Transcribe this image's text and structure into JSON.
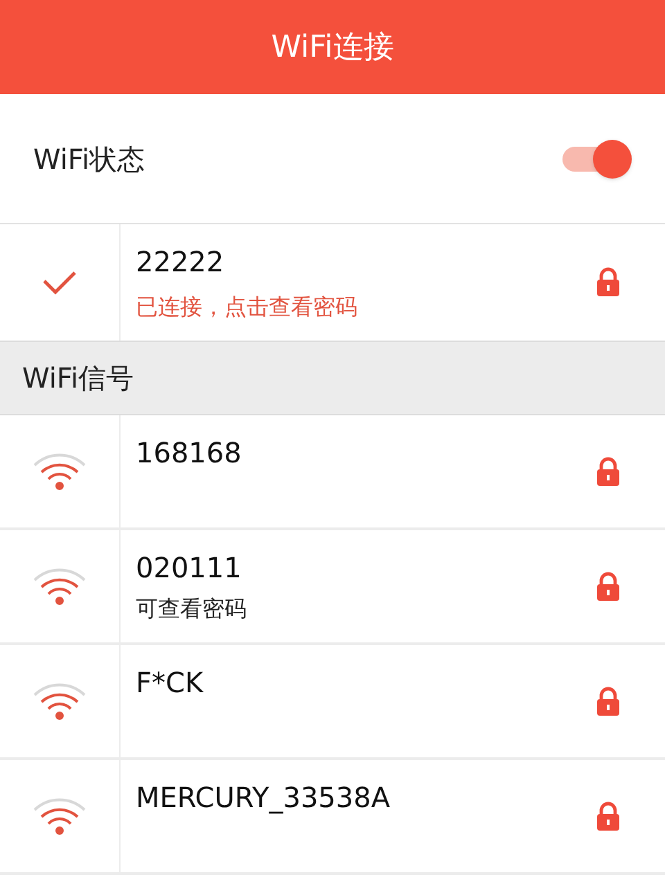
{
  "header": {
    "title": "WiFi连接"
  },
  "wifi_status": {
    "label": "WiFi状态",
    "on": true
  },
  "connected": {
    "name": "22222",
    "status": "已连接，点击查看密码",
    "locked": true
  },
  "section": {
    "title": "WiFi信号"
  },
  "networks": [
    {
      "name": "168168",
      "locked": true
    },
    {
      "name": "020111",
      "note": "可查看密码",
      "locked": true
    },
    {
      "name": "F*CK",
      "locked": true
    },
    {
      "name": "MERCURY_33538A",
      "locked": true
    }
  ]
}
